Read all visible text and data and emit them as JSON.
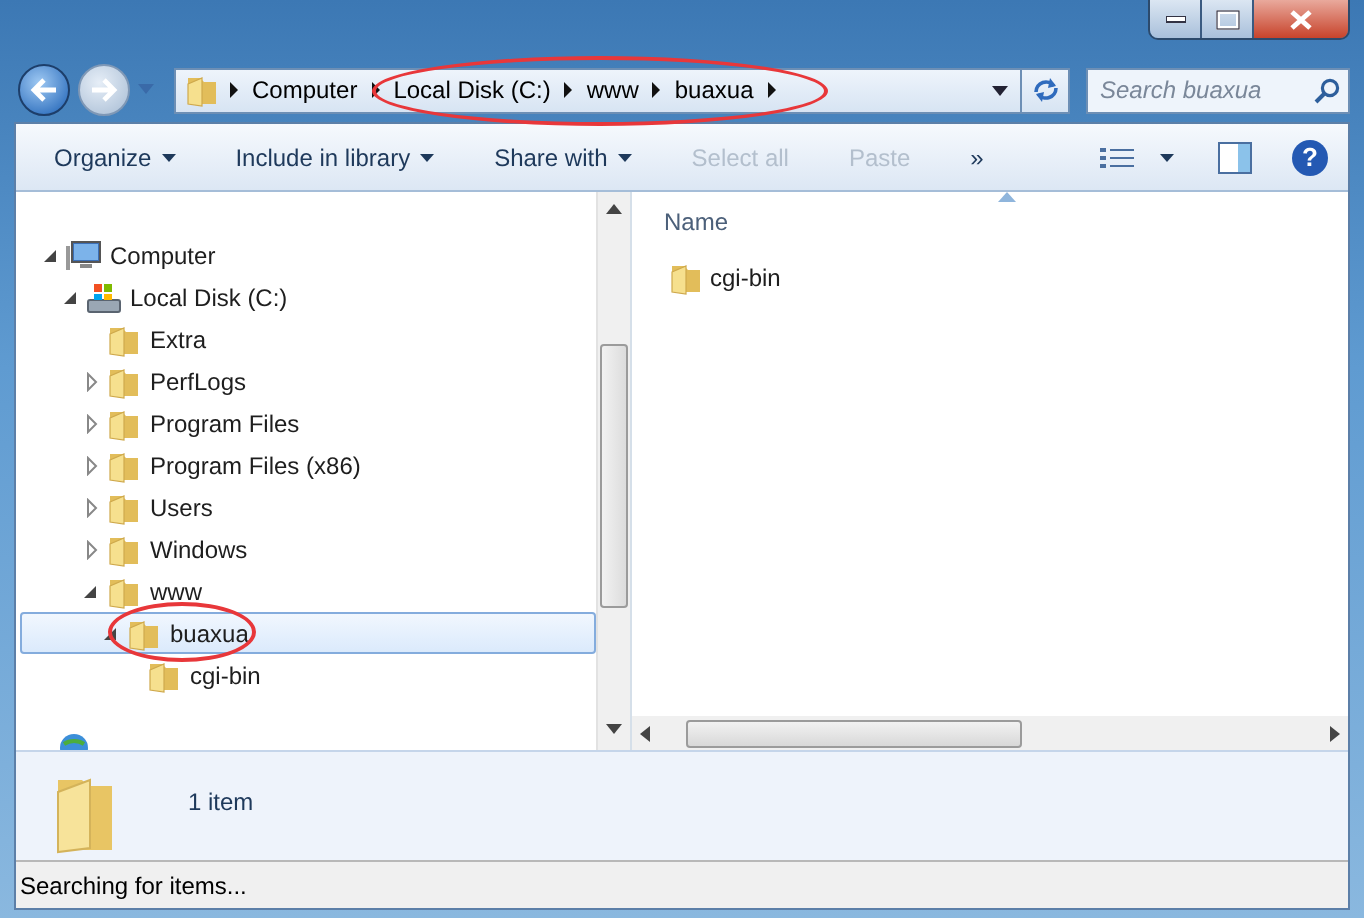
{
  "address_bar": {
    "segments": [
      "Computer",
      "Local Disk (C:)",
      "www",
      "buaxua"
    ]
  },
  "search": {
    "placeholder": "Search buaxua"
  },
  "toolbar": [
    {
      "label": "Organize",
      "dropdown": true,
      "disabled": false
    },
    {
      "label": "Include in library",
      "dropdown": true,
      "disabled": false
    },
    {
      "label": "Share with",
      "dropdown": true,
      "disabled": false
    },
    {
      "label": "Select all",
      "dropdown": false,
      "disabled": true
    },
    {
      "label": "Paste",
      "dropdown": false,
      "disabled": true
    },
    {
      "label": "»",
      "dropdown": false,
      "disabled": false
    }
  ],
  "help_button": {
    "label": "?"
  },
  "navigation_tree": [
    {
      "label": "Computer",
      "kind": "computer",
      "expandable": true,
      "expanded": true,
      "selected": false,
      "children": [
        {
          "label": "Local Disk (C:)",
          "kind": "drive",
          "expandable": true,
          "expanded": true,
          "selected": false,
          "children": [
            {
              "label": "Extra",
              "kind": "folder",
              "expandable": false,
              "selected": false
            },
            {
              "label": "PerfLogs",
              "kind": "folder",
              "expandable": true,
              "expanded": false,
              "selected": false
            },
            {
              "label": "Program Files",
              "kind": "folder",
              "expandable": true,
              "expanded": false,
              "selected": false
            },
            {
              "label": "Program Files (x86)",
              "kind": "folder",
              "expandable": true,
              "expanded": false,
              "selected": false
            },
            {
              "label": "Users",
              "kind": "folder",
              "expandable": true,
              "expanded": false,
              "selected": false
            },
            {
              "label": "Windows",
              "kind": "folder",
              "expandable": true,
              "expanded": false,
              "selected": false
            },
            {
              "label": "www",
              "kind": "folder",
              "expandable": true,
              "expanded": true,
              "selected": false,
              "children": [
                {
                  "label": "buaxua",
                  "kind": "folder",
                  "expandable": true,
                  "expanded": true,
                  "selected": true,
                  "children": [
                    {
                      "label": "cgi-bin",
                      "kind": "folder",
                      "expandable": false,
                      "selected": false
                    }
                  ]
                }
              ]
            }
          ]
        }
      ]
    }
  ],
  "file_list": {
    "columns": [
      "Name"
    ],
    "items": [
      {
        "name": "cgi-bin"
      }
    ]
  },
  "details_pane": {
    "summary": "1 item"
  },
  "status_bar": "Searching for items..."
}
